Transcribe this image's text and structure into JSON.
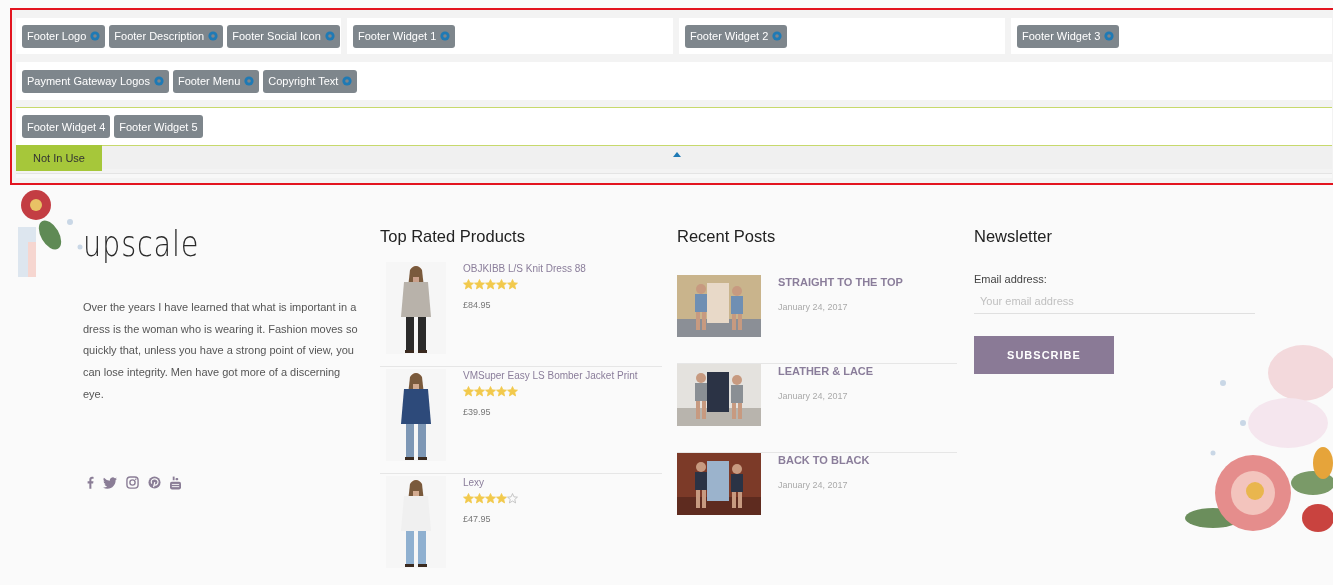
{
  "builder": {
    "columns": [
      {
        "chips": [
          {
            "label": "Footer Logo",
            "settings": true
          },
          {
            "label": "Footer Description",
            "settings": true
          },
          {
            "label": "Footer Social Icon",
            "settings": true
          }
        ]
      },
      {
        "chips": [
          {
            "label": "Footer Widget 1",
            "settings": true
          }
        ]
      },
      {
        "chips": [
          {
            "label": "Footer Widget 2",
            "settings": true
          }
        ]
      },
      {
        "chips": [
          {
            "label": "Footer Widget 3",
            "settings": true
          }
        ]
      }
    ],
    "bottom_row": [
      {
        "label": "Payment Gateway Logos",
        "settings": true
      },
      {
        "label": "Footer Menu",
        "settings": true
      },
      {
        "label": "Copyright Text",
        "settings": true
      }
    ],
    "unused_row": [
      {
        "label": "Footer Widget 4",
        "settings": false
      },
      {
        "label": "Footer Widget 5",
        "settings": false
      }
    ],
    "unused_tab": "Not In Use"
  },
  "footer": {
    "logo": "upscale",
    "description": "Over the years I have learned that what is important in a dress is the woman who is wearing it. Fashion moves so quickly that, unless you have a strong point of view, you can lose integrity. Men have got more of a discerning eye.",
    "social": [
      {
        "kind": "facebook"
      },
      {
        "kind": "twitter"
      },
      {
        "kind": "instagram"
      },
      {
        "kind": "pinterest"
      },
      {
        "kind": "youtube"
      }
    ],
    "products": {
      "title": "Top Rated Products",
      "items": [
        {
          "name": "OBJKIBB L/S Knit Dress 88",
          "stars": 5,
          "price": "£84.95"
        },
        {
          "name": "VMSuper Easy LS Bomber Jacket Print",
          "stars": 5,
          "price": "£39.95"
        },
        {
          "name": "Lexy",
          "stars": 4,
          "price": "£47.95"
        }
      ]
    },
    "posts": {
      "title": "Recent Posts",
      "items": [
        {
          "title": "STRAIGHT TO THE TOP",
          "date": "January 24, 2017"
        },
        {
          "title": "LEATHER & LACE",
          "date": "January 24, 2017"
        },
        {
          "title": "BACK TO BLACK",
          "date": "January 24, 2017"
        }
      ]
    },
    "newsletter": {
      "title": "Newsletter",
      "label": "Email address:",
      "placeholder": "Your email address",
      "button": "SUBSCRIBE"
    }
  }
}
